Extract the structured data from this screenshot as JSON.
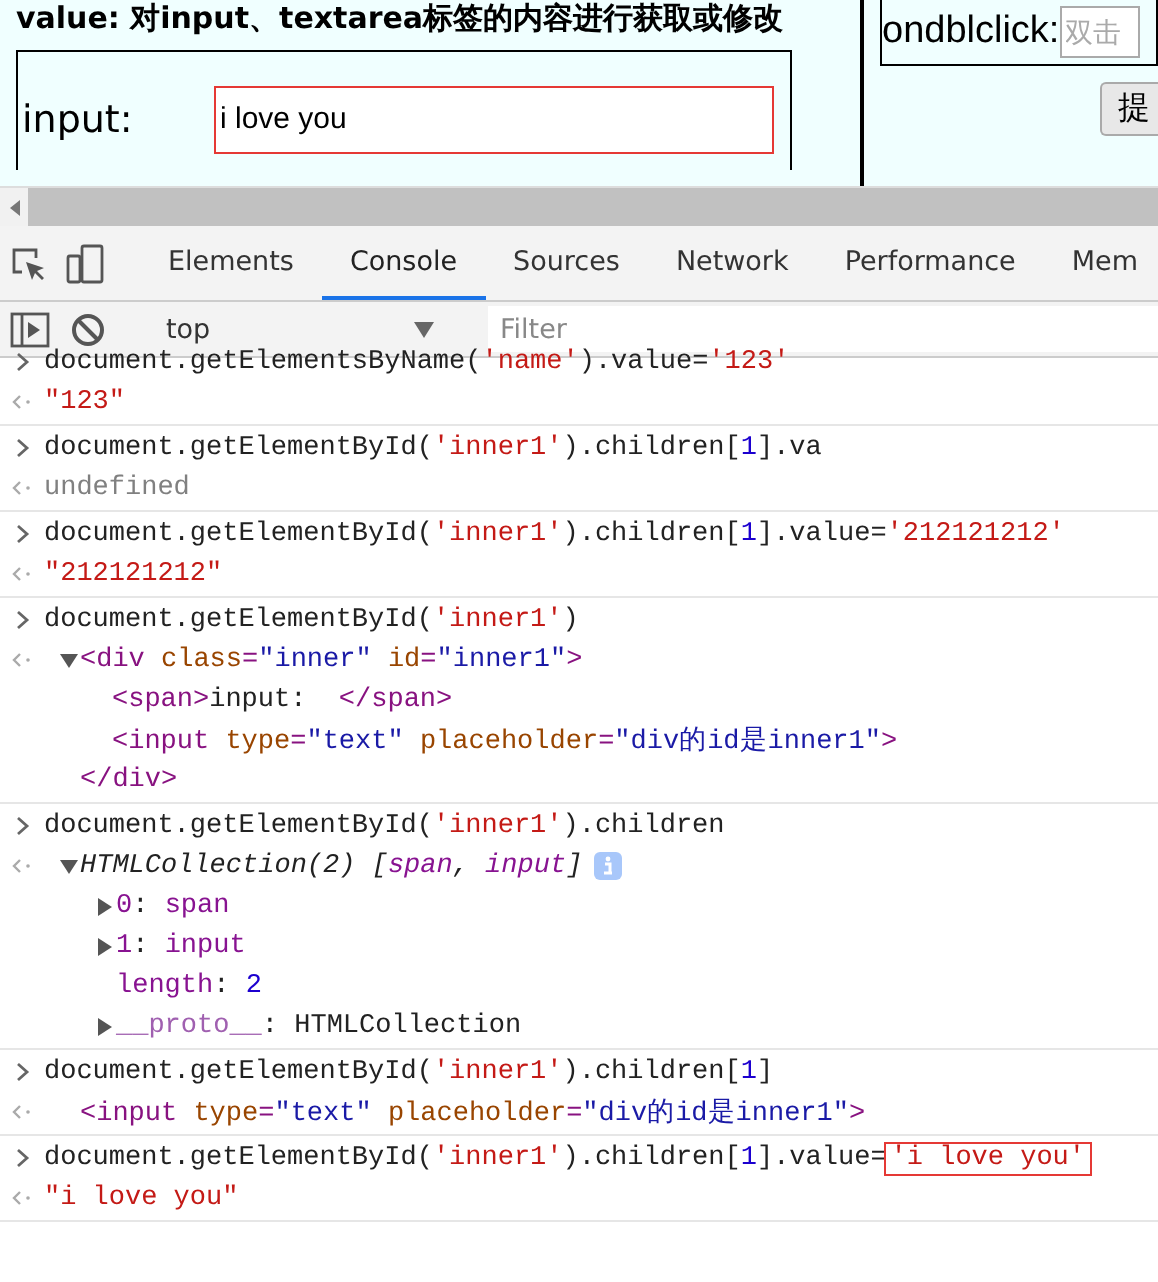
{
  "page": {
    "heading": "value: 对input、textarea标签的内容进行获取或修改",
    "input_label": "input:",
    "input_value": "i love you",
    "input_annotated": true,
    "dblclick_label": "ondblclick:",
    "dblclick_placeholder": "双击",
    "button_label": "提"
  },
  "tabs": [
    {
      "label": "Elements",
      "selected": false
    },
    {
      "label": "Console",
      "selected": true
    },
    {
      "label": "Sources",
      "selected": false
    },
    {
      "label": "Network",
      "selected": false
    },
    {
      "label": "Performance",
      "selected": false
    },
    {
      "label": "Mem",
      "selected": false
    }
  ],
  "toolbar": {
    "context": "top",
    "filter_placeholder": "Filter"
  },
  "console": [
    {
      "input": [
        {
          "text": "document.getElementsByName(",
          "kind": "plain"
        },
        {
          "text": "'name'",
          "kind": "string"
        },
        {
          "text": ").value=",
          "kind": "plain"
        },
        {
          "text": "'123'",
          "kind": "string"
        }
      ],
      "output": {
        "parts": [
          {
            "text": "\"123\"",
            "kind": "string"
          }
        ]
      }
    },
    {
      "input": [
        {
          "text": "document.getElementById(",
          "kind": "plain"
        },
        {
          "text": "'inner1'",
          "kind": "string"
        },
        {
          "text": ").children[",
          "kind": "plain"
        },
        {
          "text": "1",
          "kind": "number"
        },
        {
          "text": "].va",
          "kind": "plain"
        }
      ],
      "output": {
        "parts": [
          {
            "text": "undefined",
            "kind": "gray"
          }
        ]
      }
    },
    {
      "input": [
        {
          "text": "document.getElementById(",
          "kind": "plain"
        },
        {
          "text": "'inner1'",
          "kind": "string"
        },
        {
          "text": ").children[",
          "kind": "plain"
        },
        {
          "text": "1",
          "kind": "number"
        },
        {
          "text": "].value=",
          "kind": "plain"
        },
        {
          "text": "'212121212'",
          "kind": "string"
        }
      ],
      "output": {
        "parts": [
          {
            "text": "\"212121212\"",
            "kind": "string"
          }
        ]
      }
    },
    {
      "input": [
        {
          "text": "document.getElementById(",
          "kind": "plain"
        },
        {
          "text": "'inner1'",
          "kind": "string"
        },
        {
          "text": ")",
          "kind": "plain"
        }
      ],
      "output": {
        "expanded": true,
        "parts": [
          {
            "text": "<div",
            "kind": "tag"
          },
          {
            "text": " class",
            "kind": "attr"
          },
          {
            "text": "=",
            "kind": "tag"
          },
          {
            "text": "\"inner\"",
            "kind": "attrval"
          },
          {
            "text": " id",
            "kind": "attr"
          },
          {
            "text": "=",
            "kind": "tag"
          },
          {
            "text": "\"inner1\"",
            "kind": "attrval"
          },
          {
            "text": ">",
            "kind": "tag"
          }
        ],
        "children": [
          {
            "parts": [
              {
                "text": "<span>",
                "kind": "tag"
              },
              {
                "text": "input:  ",
                "kind": "plain"
              },
              {
                "text": "</span>",
                "kind": "tag"
              }
            ]
          },
          {
            "parts": [
              {
                "text": "<input",
                "kind": "tag"
              },
              {
                "text": " type",
                "kind": "attr"
              },
              {
                "text": "=",
                "kind": "tag"
              },
              {
                "text": "\"text\"",
                "kind": "attrval"
              },
              {
                "text": " placeholder",
                "kind": "attr"
              },
              {
                "text": "=",
                "kind": "tag"
              },
              {
                "text": "\"div的id是inner1\"",
                "kind": "attrval"
              },
              {
                "text": ">",
                "kind": "tag"
              }
            ]
          }
        ],
        "close": [
          {
            "text": "</div>",
            "kind": "tag"
          }
        ]
      }
    },
    {
      "input": [
        {
          "text": "document.getElementById(",
          "kind": "plain"
        },
        {
          "text": "'inner1'",
          "kind": "string"
        },
        {
          "text": ").children",
          "kind": "plain"
        }
      ],
      "output": {
        "expanded": true,
        "info": true,
        "parts": [
          {
            "text": "HTMLCollection(2) [",
            "kind": "italic"
          },
          {
            "text": "span",
            "kind": "italickey"
          },
          {
            "text": ", ",
            "kind": "italic"
          },
          {
            "text": "input",
            "kind": "italickey"
          },
          {
            "text": "]",
            "kind": "italic"
          }
        ],
        "children": [
          {
            "expanded": false,
            "parts": [
              {
                "text": "0",
                "kind": "key"
              },
              {
                "text": ": ",
                "kind": "plain"
              },
              {
                "text": "span",
                "kind": "key"
              }
            ]
          },
          {
            "expanded": false,
            "parts": [
              {
                "text": "1",
                "kind": "key"
              },
              {
                "text": ": ",
                "kind": "plain"
              },
              {
                "text": "input",
                "kind": "key"
              }
            ]
          },
          {
            "parts": [
              {
                "text": "length",
                "kind": "key"
              },
              {
                "text": ": ",
                "kind": "plain"
              },
              {
                "text": "2",
                "kind": "number"
              }
            ]
          },
          {
            "expanded": false,
            "parts": [
              {
                "text": "__proto__",
                "kind": "dimkey"
              },
              {
                "text": ": HTMLCollection",
                "kind": "plain"
              }
            ]
          }
        ]
      }
    },
    {
      "input": [
        {
          "text": "document.getElementById(",
          "kind": "plain"
        },
        {
          "text": "'inner1'",
          "kind": "string"
        },
        {
          "text": ").children[",
          "kind": "plain"
        },
        {
          "text": "1",
          "kind": "number"
        },
        {
          "text": "]",
          "kind": "plain"
        }
      ],
      "output": {
        "indented": true,
        "parts": [
          {
            "text": "<input",
            "kind": "tag"
          },
          {
            "text": " type",
            "kind": "attr"
          },
          {
            "text": "=",
            "kind": "tag"
          },
          {
            "text": "\"text\"",
            "kind": "attrval"
          },
          {
            "text": " placeholder",
            "kind": "attr"
          },
          {
            "text": "=",
            "kind": "tag"
          },
          {
            "text": "\"div的id是inner1\"",
            "kind": "attrval"
          },
          {
            "text": ">",
            "kind": "tag"
          }
        ]
      }
    },
    {
      "input": [
        {
          "text": "document.getElementById(",
          "kind": "plain"
        },
        {
          "text": "'inner1'",
          "kind": "string"
        },
        {
          "text": ").children[",
          "kind": "plain"
        },
        {
          "text": "1",
          "kind": "number"
        },
        {
          "text": "].value=",
          "kind": "plain"
        },
        {
          "text": "'i love you'",
          "kind": "string",
          "annotated": true
        }
      ],
      "output": {
        "parts": [
          {
            "text": "\"i love you\"",
            "kind": "string"
          }
        ]
      }
    }
  ]
}
